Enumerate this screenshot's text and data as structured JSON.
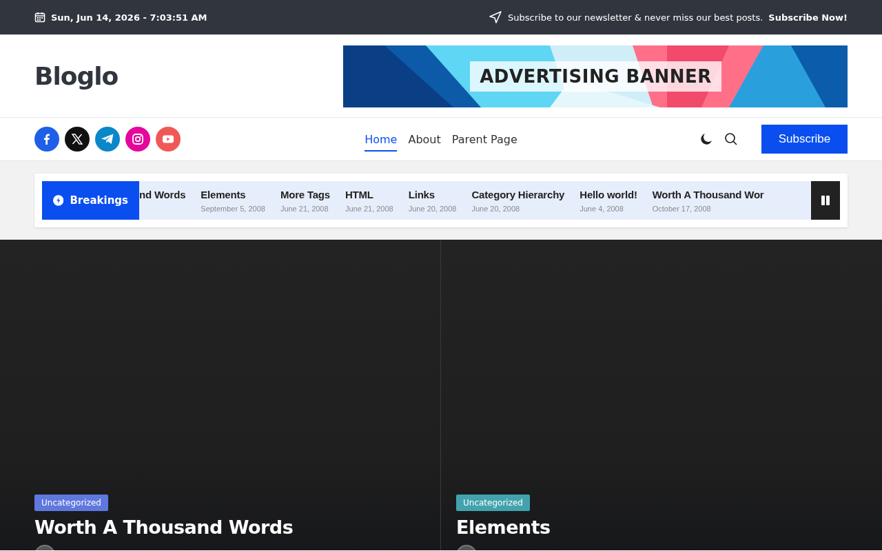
{
  "top_bar": {
    "datetime": "Sun, Jun 14, 2026 - 7:03:51 AM",
    "newsletter_text": "Subscribe to our newsletter & never miss our best posts.",
    "newsletter_link": "Subscribe Now!"
  },
  "header": {
    "site_title": "Bloglo",
    "banner": {
      "kind": "picture",
      "text": "ADVERTISING BANNER"
    }
  },
  "social_links": [
    {
      "kind": "facebook",
      "color": "#1f5fe8"
    },
    {
      "kind": "x",
      "color": "#111111"
    },
    {
      "kind": "telegram",
      "color": "#0a87c9"
    },
    {
      "kind": "instagram",
      "color": "#e4079c"
    },
    {
      "kind": "youtube",
      "color": "#f05858"
    }
  ],
  "nav": [
    {
      "label": "Home",
      "selected": true
    },
    {
      "label": "About",
      "selected": false
    },
    {
      "label": "Parent Page",
      "selected": false
    }
  ],
  "subscribe_button": "Subscribe",
  "ticker": {
    "label": "Breakings",
    "items": [
      {
        "title": "nd Words"
      },
      {
        "title": "Elements",
        "date": "September 5, 2008"
      },
      {
        "title": "More Tags",
        "date": "June 21, 2008"
      },
      {
        "title": "HTML",
        "date": "June 21, 2008"
      },
      {
        "title": "Links",
        "date": "June 20, 2008"
      },
      {
        "title": "Category Hierarchy",
        "date": "June 20, 2008"
      },
      {
        "title": "Hello world!",
        "date": "June 4, 2008"
      },
      {
        "title": "Worth A Thousand Wor",
        "date": "October 17, 2008"
      }
    ]
  },
  "featured_posts": [
    {
      "category": "Uncategorized",
      "color": "#5f78de",
      "title": "Worth A Thousand Words"
    },
    {
      "category": "Uncategorized",
      "color": "#42a3ad",
      "title": "Elements"
    }
  ]
}
